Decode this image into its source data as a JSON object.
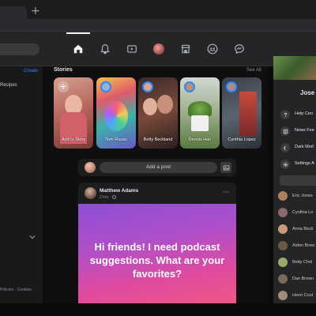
{
  "browser": {
    "new_tab_glyph": "+"
  },
  "nav": {
    "items": [
      {
        "icon": "home-icon",
        "active": true
      },
      {
        "icon": "bell-icon",
        "active": false
      },
      {
        "icon": "watch-icon",
        "active": false
      },
      {
        "icon": "profile-avatar",
        "active": false
      },
      {
        "icon": "marketplace-icon",
        "active": false
      },
      {
        "icon": "groups-icon",
        "active": false
      },
      {
        "icon": "messenger-icon",
        "active": false
      }
    ]
  },
  "left": {
    "create_label": "Create",
    "recipes_label": "Recipes",
    "footer_text": "Policies · Cookies ·"
  },
  "stories": {
    "title": "Stories",
    "see_all": "See All",
    "items": [
      {
        "label": "Add to Story",
        "kind": "add",
        "bg": "#c27b73"
      },
      {
        "label": "Tom Russo",
        "kind": "friend",
        "bg": "#3aa7a0"
      },
      {
        "label": "Betty Beckland",
        "kind": "friend",
        "bg": "#8b5a4a"
      },
      {
        "label": "Dennis Han",
        "kind": "friend",
        "bg": "#6f8f53"
      },
      {
        "label": "Cynthia Lopez",
        "kind": "friend",
        "bg": "#505a66"
      }
    ]
  },
  "composer": {
    "placeholder": "Add a post"
  },
  "post": {
    "author": "Matthew Adams",
    "meta": "2 hrs · ",
    "more": "···",
    "text": "Hi friends! I need podcast suggestions. What are your favorites?"
  },
  "right": {
    "name": "Jose",
    "menu": [
      {
        "label": "Help Cen",
        "icon": "help-icon"
      },
      {
        "label": "News Fee",
        "icon": "news-feed-icon"
      },
      {
        "label": "Dark Mod",
        "icon": "dark-mode-icon"
      },
      {
        "label": "Settings A",
        "icon": "gear-icon"
      }
    ],
    "contacts": [
      {
        "name": "Eric Jones",
        "color": "#b0805a"
      },
      {
        "name": "Cynthia Lo",
        "color": "#8a6a6a"
      },
      {
        "name": "Anna Beck",
        "color": "#c99a7a"
      },
      {
        "name": "Aiden Brow",
        "color": "#6a5a4a"
      },
      {
        "name": "Betty Chel",
        "color": "#9aa86a"
      },
      {
        "name": "Dan Brown",
        "color": "#7a6a5a"
      },
      {
        "name": "Henri Cool",
        "color": "#a08a7a"
      }
    ]
  }
}
